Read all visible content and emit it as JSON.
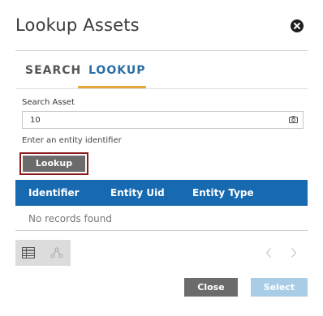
{
  "dialog": {
    "title": "Lookup Assets",
    "close_icon": "close-circle-icon"
  },
  "tabs": [
    {
      "label": "SEARCH",
      "active": false
    },
    {
      "label": "LOOKUP",
      "active": true
    }
  ],
  "form": {
    "field_label": "Search Asset",
    "value": "10",
    "placeholder": "",
    "hint": "Enter an entity identifier",
    "camera_icon": "camera-icon",
    "lookup_button": "Lookup"
  },
  "table": {
    "columns": [
      "Identifier",
      "Entity Uid",
      "Entity Type"
    ],
    "rows": [],
    "empty_text": "No records found"
  },
  "footer": {
    "view_icons": [
      "grid-view-icon",
      "tree-view-icon"
    ],
    "pager_icons": [
      "chevron-left-icon",
      "chevron-right-icon"
    ],
    "close_label": "Close",
    "select_label": "Select"
  },
  "colors": {
    "accent": "#1769b0",
    "tab_underline": "#e6a63a",
    "highlight_outline": "#8b1a1a",
    "button_gray": "#6b6b6b",
    "select_disabled": "#a9cde6"
  }
}
